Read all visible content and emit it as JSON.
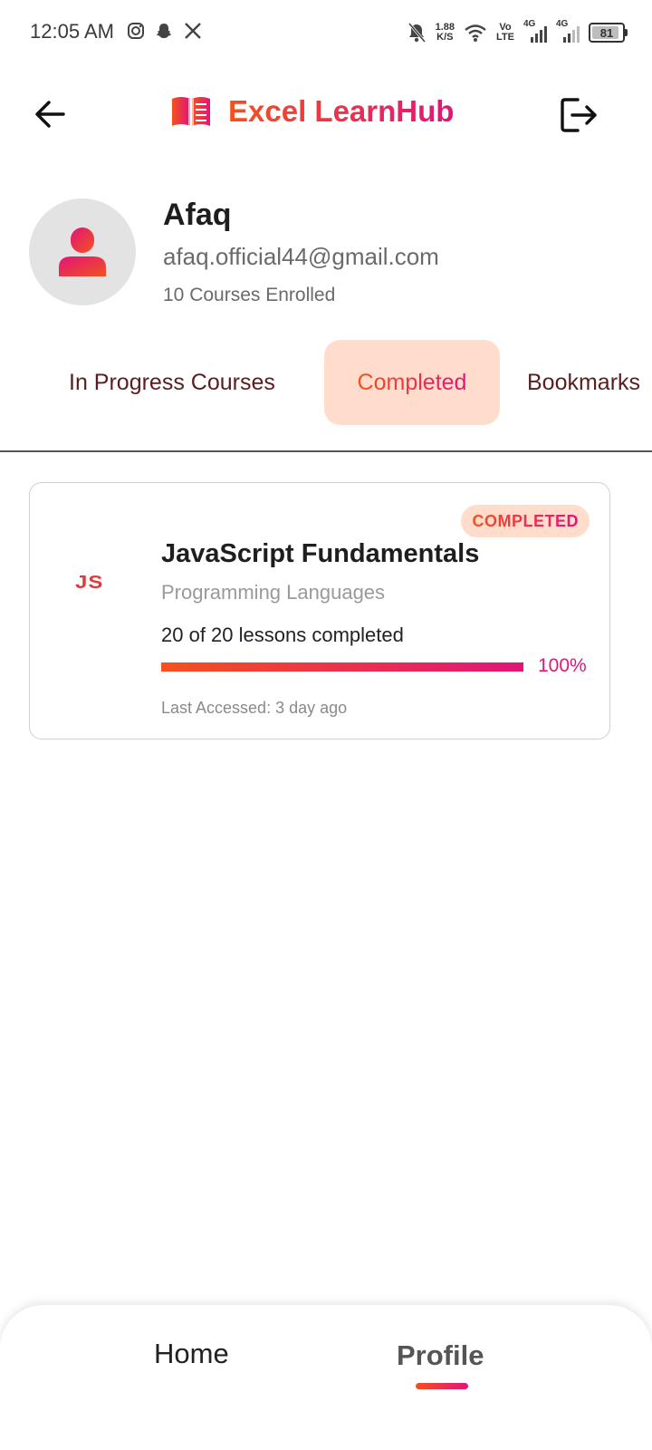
{
  "status_bar": {
    "time": "12:05 AM",
    "left_icons": [
      "instagram-icon",
      "snapchat-icon",
      "x-icon"
    ],
    "net_speed_value": "1.88",
    "net_speed_unit": "K/S",
    "volte_top": "Vo",
    "volte_bottom": "LTE",
    "signal1_label": "4G",
    "signal2_label": "4G",
    "battery": "81"
  },
  "header": {
    "app_title": "Excel LearnHub",
    "back_icon": "arrow-left-icon",
    "logout_icon": "logout-icon",
    "logo_icon": "book-icon"
  },
  "profile": {
    "name": "Afaq",
    "email": "afaq.official44@gmail.com",
    "enrolled": "10 Courses Enrolled"
  },
  "tabs": [
    {
      "label": "In Progress Courses",
      "active": false
    },
    {
      "label": "Completed",
      "active": true
    },
    {
      "label": "Bookmarks",
      "active": false
    }
  ],
  "course": {
    "badge": "COMPLETED",
    "logo_text": "JS",
    "title": "JavaScript Fundamentals",
    "category": "Programming Languages",
    "lessons": "20 of 20 lessons completed",
    "progress_percent": 100,
    "progress_label": "100%",
    "last_accessed": "Last Accessed: 3 day ago"
  },
  "bottom_nav": {
    "home": "Home",
    "profile": "Profile",
    "active": "profile"
  },
  "colors": {
    "accent_start": "#f4511e",
    "accent_end": "#e0157a",
    "active_tab_bg": "#ffdccb",
    "tab_text": "#5a1e1e"
  }
}
